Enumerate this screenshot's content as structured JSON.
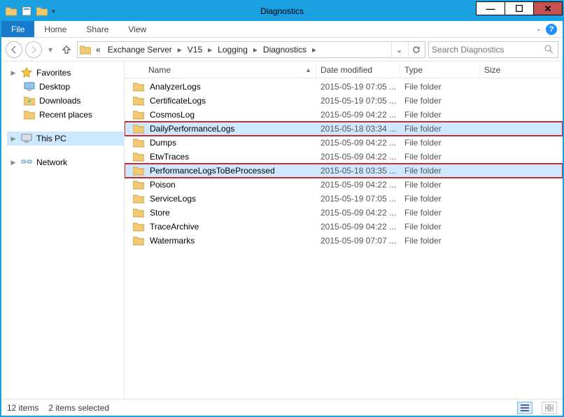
{
  "window": {
    "title": "Diagnostics"
  },
  "ribbon": {
    "file": "File",
    "tabs": [
      "Home",
      "Share",
      "View"
    ]
  },
  "address": {
    "prefix": "«",
    "crumbs": [
      "Exchange Server",
      "V15",
      "Logging",
      "Diagnostics"
    ]
  },
  "search": {
    "placeholder": "Search Diagnostics"
  },
  "nav": {
    "favorites": {
      "label": "Favorites",
      "items": [
        "Desktop",
        "Downloads",
        "Recent places"
      ]
    },
    "thispc": {
      "label": "This PC"
    },
    "network": {
      "label": "Network"
    }
  },
  "columns": {
    "name": "Name",
    "date": "Date modified",
    "type": "Type",
    "size": "Size"
  },
  "items": [
    {
      "name": "AnalyzerLogs",
      "date": "2015-05-19 07:05 ...",
      "type": "File folder",
      "selected": false,
      "highlight": false
    },
    {
      "name": "CertificateLogs",
      "date": "2015-05-19 07:05 ...",
      "type": "File folder",
      "selected": false,
      "highlight": false
    },
    {
      "name": "CosmosLog",
      "date": "2015-05-09 04:22 ...",
      "type": "File folder",
      "selected": false,
      "highlight": false
    },
    {
      "name": "DailyPerformanceLogs",
      "date": "2015-05-18 03:34 ...",
      "type": "File folder",
      "selected": true,
      "highlight": true
    },
    {
      "name": "Dumps",
      "date": "2015-05-09 04:22 ...",
      "type": "File folder",
      "selected": false,
      "highlight": false
    },
    {
      "name": "EtwTraces",
      "date": "2015-05-09 04:22 ...",
      "type": "File folder",
      "selected": false,
      "highlight": false
    },
    {
      "name": "PerformanceLogsToBeProcessed",
      "date": "2015-05-18 03:35 ...",
      "type": "File folder",
      "selected": true,
      "highlight": true
    },
    {
      "name": "Poison",
      "date": "2015-05-09 04:22 ...",
      "type": "File folder",
      "selected": false,
      "highlight": false
    },
    {
      "name": "ServiceLogs",
      "date": "2015-05-19 07:05 ...",
      "type": "File folder",
      "selected": false,
      "highlight": false
    },
    {
      "name": "Store",
      "date": "2015-05-09 04:22 ...",
      "type": "File folder",
      "selected": false,
      "highlight": false
    },
    {
      "name": "TraceArchive",
      "date": "2015-05-09 04:22 ...",
      "type": "File folder",
      "selected": false,
      "highlight": false
    },
    {
      "name": "Watermarks",
      "date": "2015-05-09 07:07 ...",
      "type": "File folder",
      "selected": false,
      "highlight": false
    }
  ],
  "status": {
    "count": "12 items",
    "selected": "2 items selected"
  }
}
